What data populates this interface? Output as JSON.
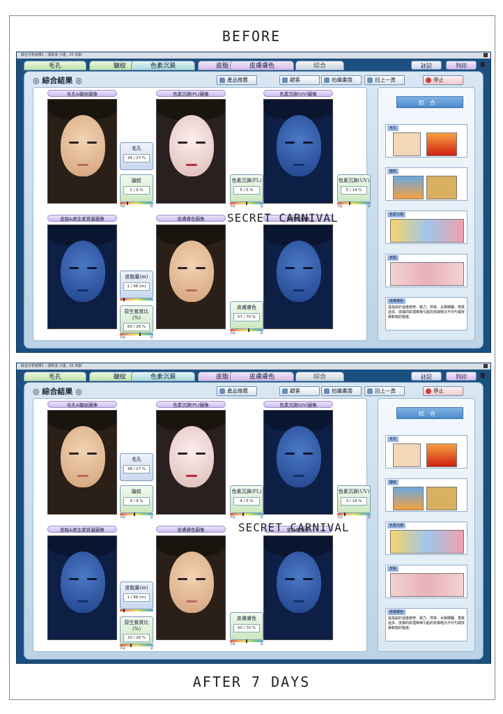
{
  "captions": {
    "before": "BEFORE",
    "after": "AFTER 7 DAYS"
  },
  "watermark": "SECRET CARNIVAL",
  "window": {
    "title": "綜合分析結果1 - 潔新潔 小姐 , 25 年齡"
  },
  "tabs": [
    "毛孔",
    "皺紋",
    "色素沉澱",
    "皮脂",
    "皮膚膚色",
    "綜合"
  ],
  "top_buttons": {
    "note": "註記",
    "print": "列印"
  },
  "page_title": "◎ 綜合結果 ◎",
  "toolbar": {
    "product": "產品推薦",
    "customer": "顧客",
    "capture": "拍攝畫面",
    "back": "回上一頁",
    "stop": "停止"
  },
  "image_labels": {
    "pore_wrinkle": "毛孔&皺紋圖像",
    "pl": "色素沉澱(PL)圖像",
    "uv": "色素沉澱(UV)圖像",
    "sebum_porphyrin": "皮脂&原生紫質量圖像",
    "skin_tone": "皮膚膚色圖像",
    "uv_bottom": "紫外線圖像"
  },
  "meter_titles": {
    "pore": "毛孔",
    "wrinkle": "皺紋",
    "pl": "色素沉澱(PL)",
    "uv": "色素沉澱(UV)",
    "sebum": "皮脂量(m)",
    "porphyrin": "原生紫質比(%)",
    "tone": "皮膚膚色"
  },
  "scale_labels": {
    "low": "不好",
    "high": "好"
  },
  "side": {
    "title": "綜合",
    "thumbs": [
      "毛孔",
      "皺紋",
      "色素沉澱",
      "皮脂"
    ],
    "desc_label": "皮膚膚色",
    "desc_text": "是指由於過度疲勞、壓力、熬夜、太陽曝曬、角質過多、皮膚的紋理等等引起的皮膚暗沉不均勻或皮膚較暗的程度。"
  },
  "before": {
    "pore": "34 / 27 %",
    "wrinkle": "2 / 9 %",
    "pl": "5 / 5 %",
    "uv": "5 / 14 %",
    "sebum": "1 / 98 (m)",
    "porphyrin": "60 / 26 %",
    "tone": "57 / 70 %",
    "levels": {
      "pore": 0.34,
      "wrinkle": 0.22,
      "pl": 0.5,
      "uv": 0.36,
      "sebum": 0.1,
      "porphyrin": 0.6,
      "tone": 0.57
    }
  },
  "after": {
    "pore": "38 / 27 %",
    "wrinkle": "4 / 9 %",
    "pl": "4 / 5 %",
    "uv": "3 / 14 %",
    "sebum": "1 / 98 (m)",
    "porphyrin": "33 / 26 %",
    "tone": "50 / 70 %",
    "levels": {
      "pore": 0.38,
      "wrinkle": 0.44,
      "pl": 0.4,
      "uv": 0.21,
      "sebum": 0.1,
      "porphyrin": 0.33,
      "tone": 0.5
    }
  },
  "colors": {
    "frame": "#1b4f80",
    "panel": "#d9e7f2",
    "side_title": "#4e8acb"
  }
}
